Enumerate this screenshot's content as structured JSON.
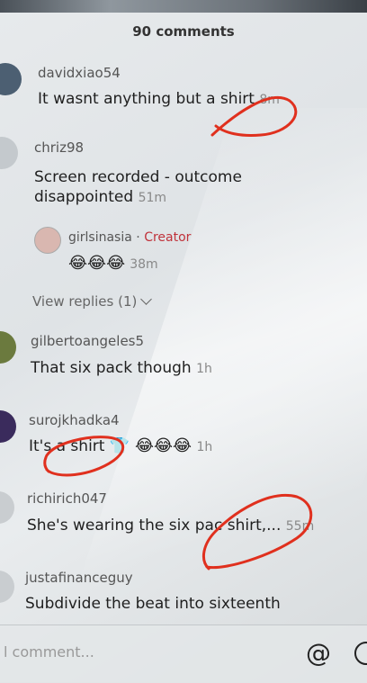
{
  "header": {
    "title": "90 comments"
  },
  "comments": [
    {
      "username": "davidxiao54",
      "text": "It wasnt anything but a shirt",
      "time": "8m"
    },
    {
      "username": "chriz98",
      "text_line1": "Screen recorded - outcome",
      "text_line2": "disappointed",
      "time": "51m",
      "reply": {
        "username": "girlsinasia",
        "separator": "·",
        "badge": "Creator",
        "emojis": "😂😂😂",
        "time": "38m"
      },
      "view_replies": "View replies (1)"
    },
    {
      "username": "gilbertoangeles5",
      "text": "That six pack though",
      "time": "1h"
    },
    {
      "username": "surojkhadka4",
      "text": "It's a shirt",
      "emojis": "👕 😂😂😂",
      "time": "1h"
    },
    {
      "username": "richirich047",
      "text": "She's wearing the six pac shirt,...",
      "time": "55m"
    },
    {
      "username": "justafinanceguy",
      "text": "Subdivide the beat into sixteenth"
    }
  ],
  "composer": {
    "placeholder": "l comment...",
    "at_icon": "@"
  },
  "colors": {
    "annotation": "#e0301e",
    "creator": "#c0323a"
  }
}
